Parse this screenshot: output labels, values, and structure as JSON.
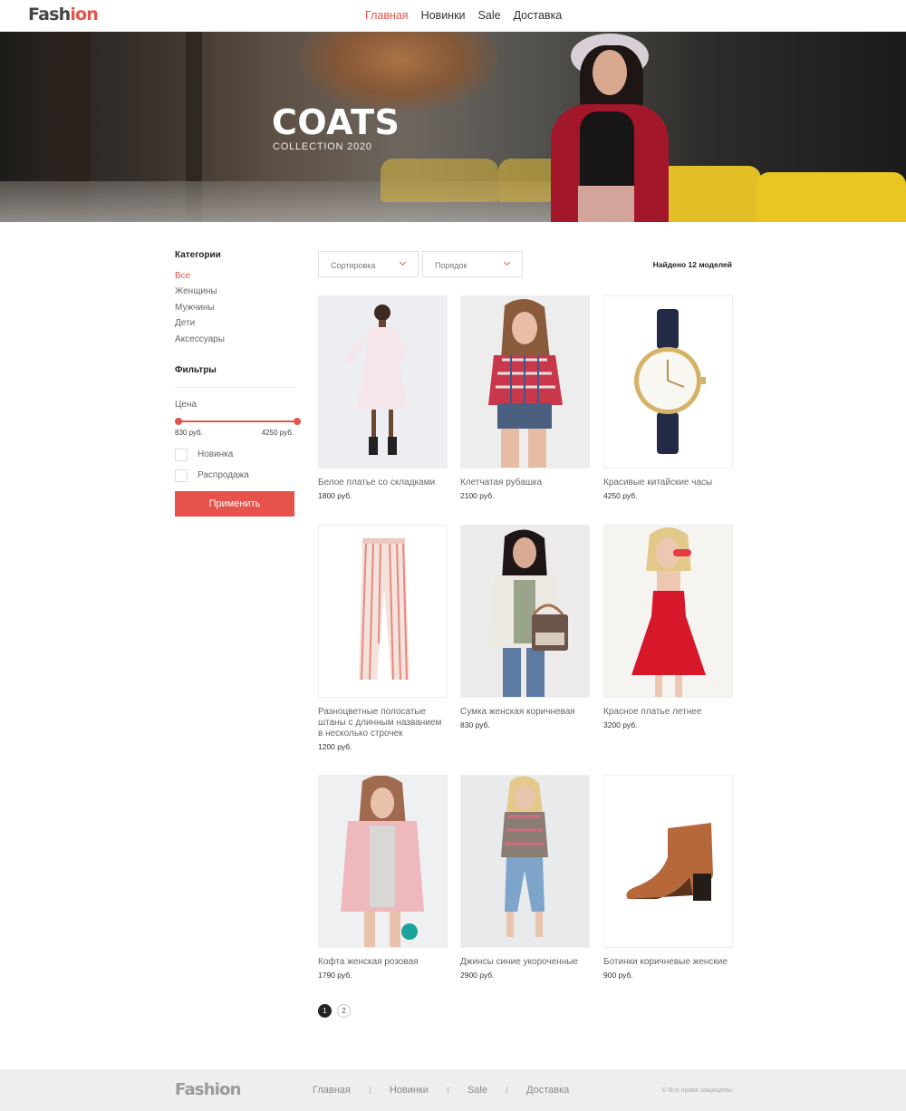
{
  "header": {
    "logo_main": "Fash",
    "logo_accent": "ion",
    "nav": [
      "Главная",
      "Новинки",
      "Sale",
      "Доставка"
    ],
    "active_nav": "Главная"
  },
  "hero": {
    "title": "COATS",
    "subtitle": "COLLECTION 2020"
  },
  "sidebar": {
    "categories_title": "Категории",
    "categories": [
      "Все",
      "Женщины",
      "Мужчины",
      "Дети",
      "Аксессуары"
    ],
    "active_category": "Все",
    "filters_title": "Фильтры",
    "price_label": "Цена",
    "price_min": "830 руб.",
    "price_max": "4250 руб.",
    "price_range_fraction": [
      0,
      1
    ],
    "checkboxes": [
      {
        "label": "Новинка",
        "checked": false
      },
      {
        "label": "Распродажа",
        "checked": false
      }
    ],
    "apply_label": "Применить"
  },
  "toolbar": {
    "sort_label": "Сортировка",
    "order_label": "Порядок",
    "found_text": "Найдено 12 моделей"
  },
  "products": [
    {
      "name": "Белое платье со складками",
      "price": "1800 руб."
    },
    {
      "name": "Клетчатая рубашка",
      "price": "2100 руб."
    },
    {
      "name": "Красивые китайские часы",
      "price": "4250 руб."
    },
    {
      "name": "Разноцветные полосатые штаны с длинным названием в несколько строчек",
      "price": "1200 руб."
    },
    {
      "name": "Сумка женская коричневая",
      "price": "830 руб."
    },
    {
      "name": "Красное платье летнее",
      "price": "3200 руб."
    },
    {
      "name": "Кофта женская розовая",
      "price": "1790 руб."
    },
    {
      "name": "Джинсы синие укороченные",
      "price": "2900 руб."
    },
    {
      "name": "Ботинки коричневые женские",
      "price": "900 руб."
    }
  ],
  "pagination": {
    "pages": [
      "1",
      "2"
    ],
    "current": "1"
  },
  "footer": {
    "logo": "Fashion",
    "nav": [
      "Главная",
      "Новинки",
      "Sale",
      "Доставка"
    ],
    "copyright": "© Все права защищены"
  },
  "colors": {
    "accent": "#e5534b",
    "footer_bg": "#eeeeee"
  }
}
